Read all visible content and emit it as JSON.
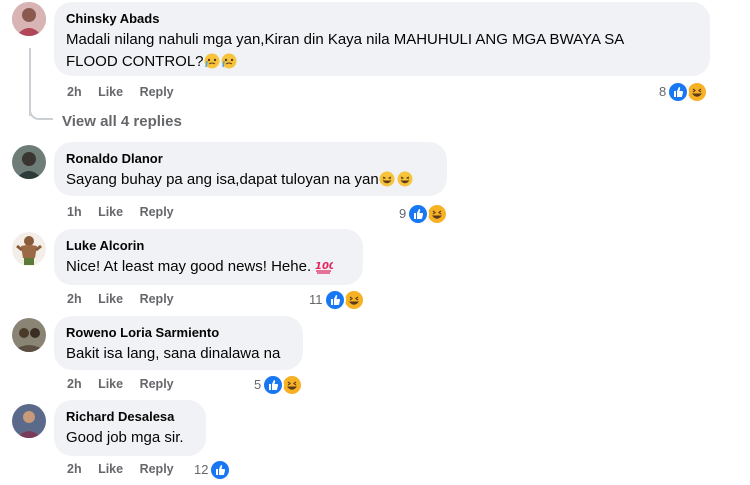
{
  "comments": [
    {
      "name": "Chinsky Abads",
      "text": "Madali nilang nahuli mga yan,Kiran din Kaya nila MAHUHULI ANG MGA BWAYA SA",
      "text2": "FLOOD CONTROL?",
      "time": "2h",
      "like": "Like",
      "reply": "Reply",
      "count": "8"
    },
    {
      "name": "Ronaldo Dlanor",
      "text": "Sayang buhay pa ang isa,dapat tuloyan na yan",
      "time": "1h",
      "like": "Like",
      "reply": "Reply",
      "count": "9"
    },
    {
      "name": "Luke Alcorin",
      "text": "Nice! At least may good news! Hehe.",
      "time": "2h",
      "like": "Like",
      "reply": "Reply",
      "count": "11"
    },
    {
      "name": "Roweno Loria Sarmiento",
      "text": "Bakit isa lang, sana dinalawa na",
      "time": "2h",
      "like": "Like",
      "reply": "Reply",
      "count": "5"
    },
    {
      "name": "Richard Desalesa",
      "text": "Good job mga sir.",
      "time": "2h",
      "like": "Like",
      "reply": "Reply",
      "count": "12"
    }
  ],
  "view_replies": "View all 4 replies",
  "colors": {
    "bubble": "#f0f2f5",
    "like": "#1877f2",
    "haha": "#f7b125",
    "meta": "#65676b"
  }
}
